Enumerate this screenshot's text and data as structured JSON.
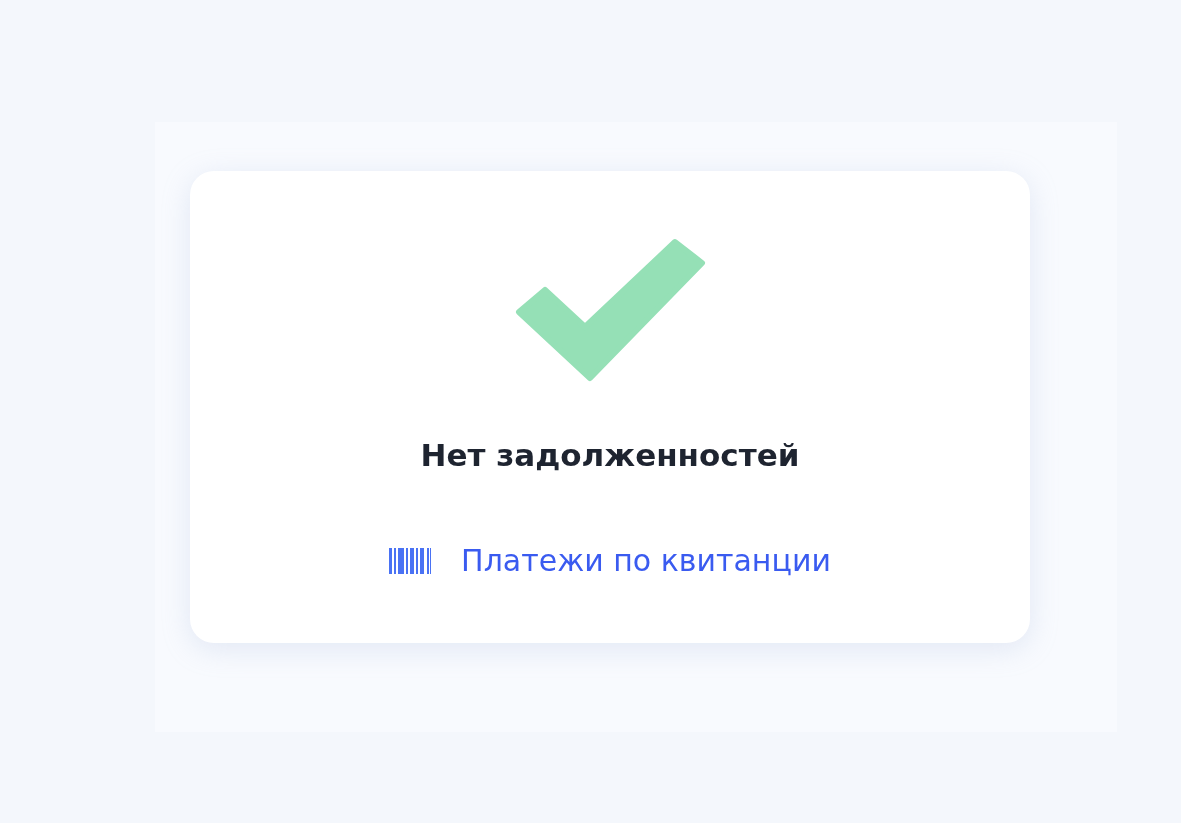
{
  "status": {
    "title": "Нет задолженностей"
  },
  "link": {
    "label": "Платежи по квитанции"
  }
}
